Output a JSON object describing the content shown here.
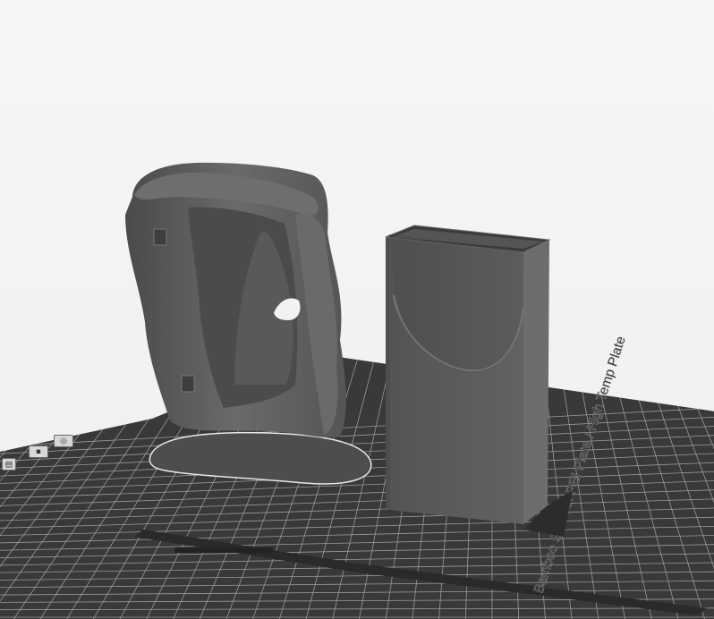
{
  "plate": {
    "label": "Bamboo Smooth PEI Plate / High Temp Plate"
  },
  "models": [
    {
      "name": "sculpted-holder"
    },
    {
      "name": "rectangular-box"
    }
  ],
  "toolbar_icons": [
    "camera-icon",
    "view-icon",
    "layers-icon"
  ],
  "colors": {
    "background": "#f3f3f3",
    "bed": "#3c3c3c",
    "grid": "#9a9a9a",
    "model": "#5e5e5e"
  }
}
